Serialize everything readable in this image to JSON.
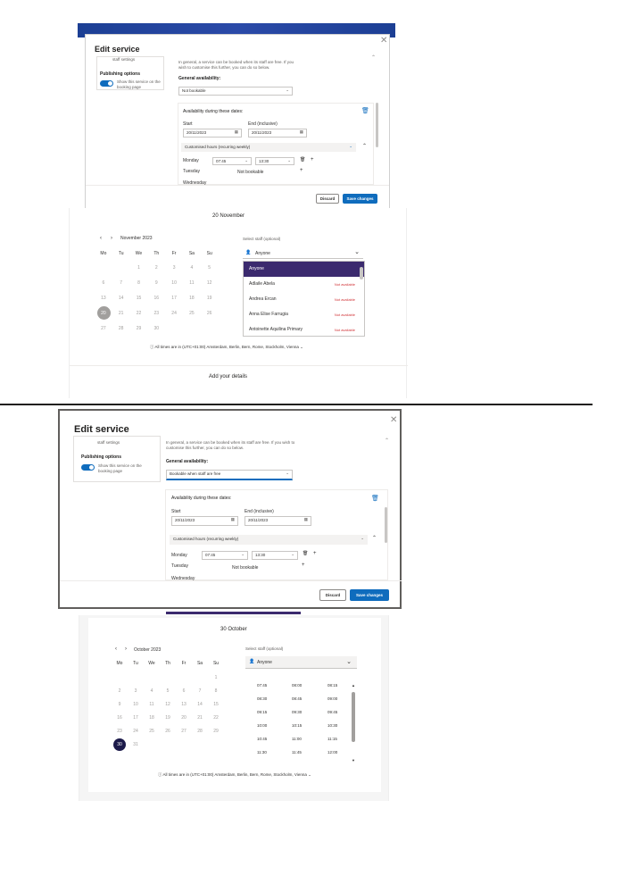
{
  "s1": {
    "title": "Edit service",
    "side_top_text": "staff settings",
    "publishing_label": "Publishing options",
    "publishing_toggle_text": "Show this service on the booking page",
    "intro": "In general, a service can be booked when its staff are free. If you wish to customise this further, you can do so below.",
    "ga_label": "General availability:",
    "ga_value": "Not bookable",
    "adtd_label": "Availability during these dates:",
    "start_label": "Start",
    "start_value": "20/11/2023",
    "end_label": "End (inclusive)",
    "end_value": "20/11/2023",
    "hours_mode": "Customised hours (recurring weekly)",
    "monday_label": "Monday",
    "mon_from": "07:45",
    "mon_to": "13:30",
    "tuesday_label": "Tuesday",
    "tuesday_value": "Not bookable",
    "wednesday_label": "Wednesday",
    "discard": "Discard",
    "save": "Save changes"
  },
  "b1": {
    "date_header": "20 November",
    "month": "November 2023",
    "weekdays": [
      "Mo",
      "Tu",
      "We",
      "Th",
      "Fr",
      "Sa",
      "Su"
    ],
    "weeks": [
      [
        "",
        "",
        "1",
        "2",
        "3",
        "4",
        "5"
      ],
      [
        "6",
        "7",
        "8",
        "9",
        "10",
        "11",
        "12"
      ],
      [
        "13",
        "14",
        "15",
        "16",
        "17",
        "18",
        "19"
      ],
      [
        "20",
        "21",
        "22",
        "23",
        "24",
        "25",
        "26"
      ],
      [
        "27",
        "28",
        "29",
        "30",
        "",
        "",
        ""
      ]
    ],
    "selected_day": "20",
    "staff_label": "Select staff (optional)",
    "staff_value": "Anyone",
    "staff_list": [
      {
        "name": "Anyone",
        "status": ""
      },
      {
        "name": "Adlaile Abela",
        "status": "Not available"
      },
      {
        "name": "Andrea Ercan",
        "status": "Not available"
      },
      {
        "name": "Anna Elise Farrugia",
        "status": "Not available"
      },
      {
        "name": "Antoinette Aquilina Primary",
        "status": "Not available"
      }
    ],
    "timezone": "All times are in (UTC+01:00) Amsterdam, Berlin, Bern, Rome, Stockholm, Vienna",
    "details": "Add your details"
  },
  "s2": {
    "title": "Edit service",
    "side_top_text": "staff settings",
    "publishing_label": "Publishing options",
    "publishing_toggle_text": "Show this service on the booking page",
    "intro": "In general, a service can be booked when its staff are free. If you wish to customise this further, you can do so below.",
    "ga_label": "General availability:",
    "ga_value": "Bookable when staff are free",
    "adtd_label": "Availability during these dates:",
    "start_label": "Start",
    "start_value": "20/11/2023",
    "end_label": "End (inclusive)",
    "end_value": "20/11/2023",
    "hours_mode": "Customised hours (recurring weekly)",
    "monday_label": "Monday",
    "mon_from": "07:45",
    "mon_to": "13:30",
    "tuesday_label": "Tuesday",
    "tuesday_value": "Not bookable",
    "wednesday_label": "Wednesday",
    "discard": "Discard",
    "save": "Save changes"
  },
  "b2": {
    "date_header": "30 October",
    "month": "October 2023",
    "weekdays": [
      "Mo",
      "Tu",
      "We",
      "Th",
      "Fr",
      "Sa",
      "Su"
    ],
    "weeks": [
      [
        "",
        "",
        "",
        "",
        "",
        "",
        "1"
      ],
      [
        "2",
        "3",
        "4",
        "5",
        "6",
        "7",
        "8"
      ],
      [
        "9",
        "10",
        "11",
        "12",
        "13",
        "14",
        "15"
      ],
      [
        "16",
        "17",
        "18",
        "19",
        "20",
        "21",
        "22"
      ],
      [
        "23",
        "24",
        "25",
        "26",
        "27",
        "28",
        "29"
      ],
      [
        "30",
        "31",
        "",
        "",
        "",
        "",
        ""
      ]
    ],
    "selected_day": "30",
    "staff_label": "Select staff (optional)",
    "staff_value": "Anyone",
    "slots": [
      [
        "07:45",
        "08:00",
        "08:15"
      ],
      [
        "08:30",
        "08:45",
        "09:00"
      ],
      [
        "09:15",
        "09:30",
        "09:45"
      ],
      [
        "10:00",
        "10:15",
        "10:30"
      ],
      [
        "10:45",
        "11:00",
        "11:15"
      ],
      [
        "11:30",
        "11:45",
        "12:00"
      ]
    ],
    "timezone": "All times are in (UTC+01:00) Amsterdam, Berlin, Bern, Rome, Stockholm, Vienna"
  },
  "colors": {
    "accent": "#0f6cbd",
    "selected_staff": "#3b2a6e",
    "banner": "#1c3f94",
    "unavailable": "#d13438"
  }
}
